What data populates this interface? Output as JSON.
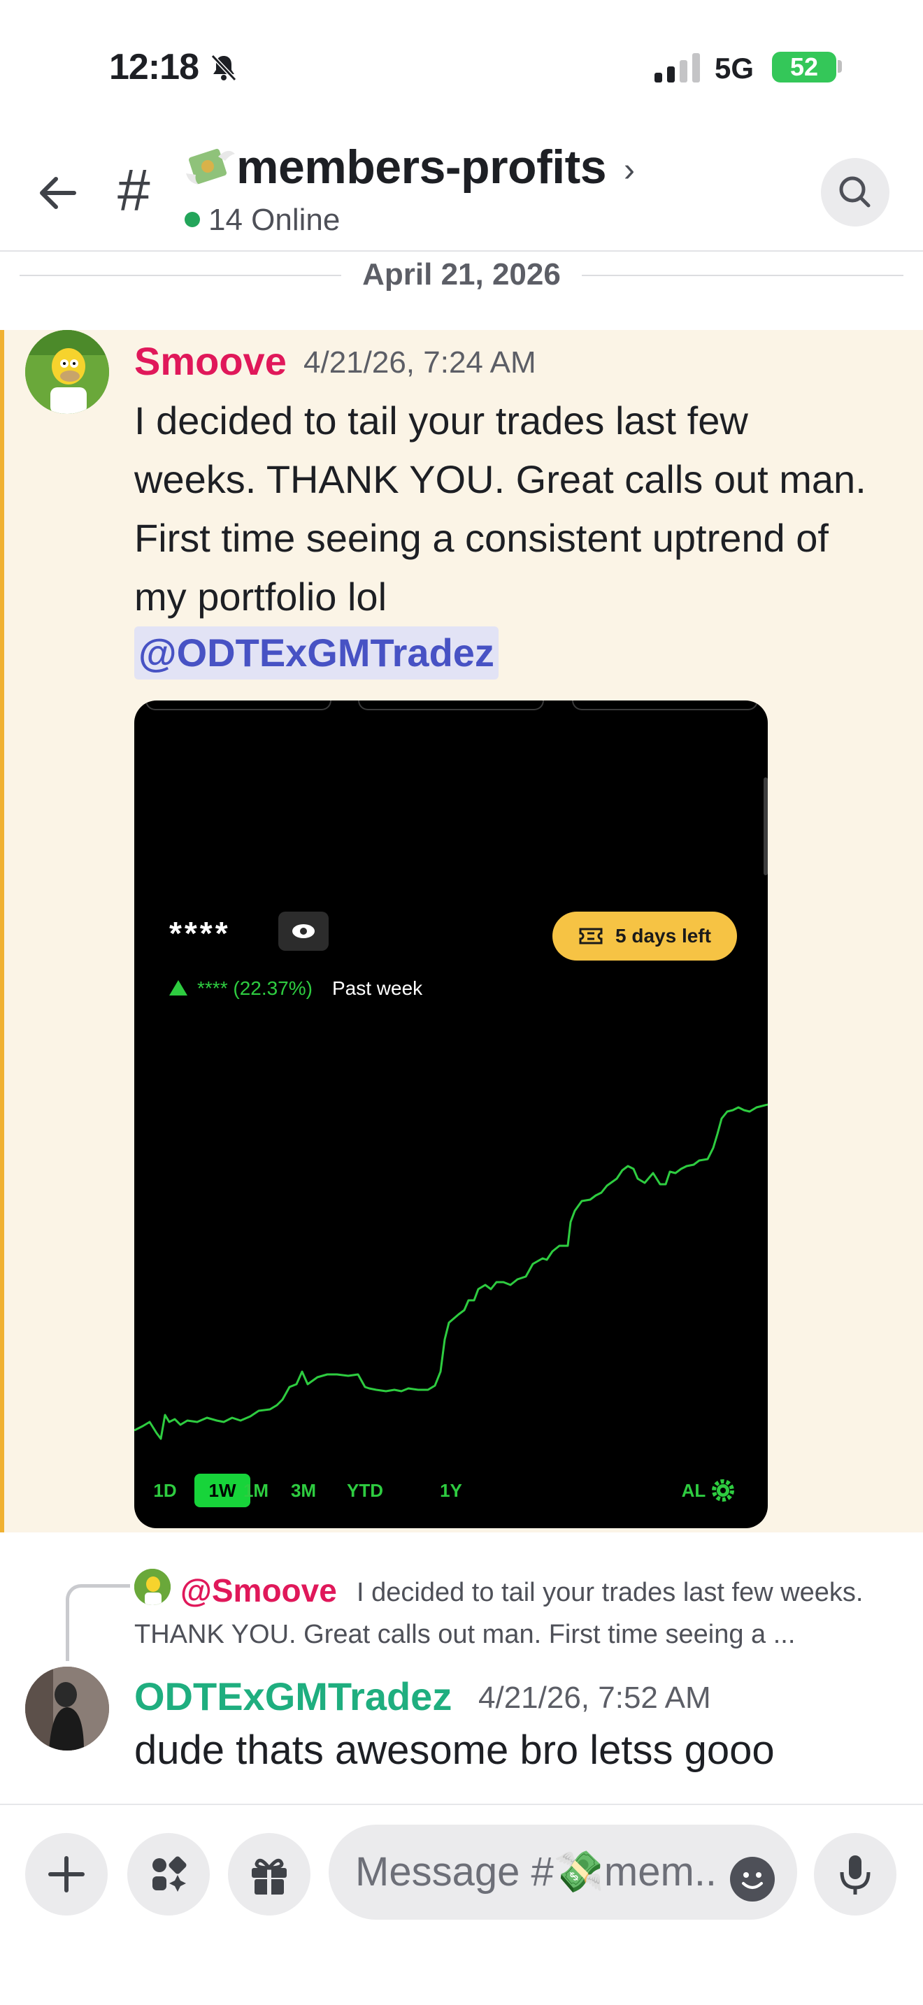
{
  "status_bar": {
    "time": "12:18",
    "network": "5G",
    "battery": "52"
  },
  "header": {
    "channel_name": "members-profits",
    "online_count": "14 Online"
  },
  "date_divider": "April 21, 2026",
  "messages": [
    {
      "author": "Smoove",
      "timestamp": "4/21/26, 7:24 AM",
      "text": "I decided to tail your trades last few weeks. THANK YOU. Great calls out man. First time seeing a consistent uptrend of my portfolio lol",
      "mention": "@ODTExGMTradez",
      "attachment": {
        "balance_masked": "****",
        "trial_pill": "5 days left",
        "perf_change": "**** (22.37%)",
        "perf_period": "Past week",
        "ranges": [
          "1D",
          "1W",
          "1M",
          "3M",
          "YTD",
          "1Y",
          "AL"
        ],
        "active_range": "1W"
      }
    },
    {
      "reply_to": {
        "author": "@Smoove",
        "preview": "I decided to tail your trades last few weeks. THANK YOU. Great calls out man. First time seeing a ..."
      },
      "author": "ODTExGMTradez",
      "timestamp": "4/21/26, 7:52 AM",
      "text": "dude thats awesome bro letss gooo"
    }
  ],
  "composer": {
    "placeholder": "Message #💸mem.."
  },
  "colors": {
    "highlight_bg": "#fbf4e6",
    "highlight_bar": "#f0b132",
    "smoove_name": "#e0185a",
    "odte_name": "#1fae7f",
    "mention": "#4752c4",
    "chart_line": "#2ecc40",
    "pill": "#f6c344"
  },
  "icons": [
    "back-arrow-icon",
    "hash-icon",
    "money-with-wings-icon",
    "chevron-right-icon",
    "search-icon",
    "plus-icon",
    "apps-icon",
    "gift-icon",
    "smile-icon",
    "microphone-icon"
  ]
}
